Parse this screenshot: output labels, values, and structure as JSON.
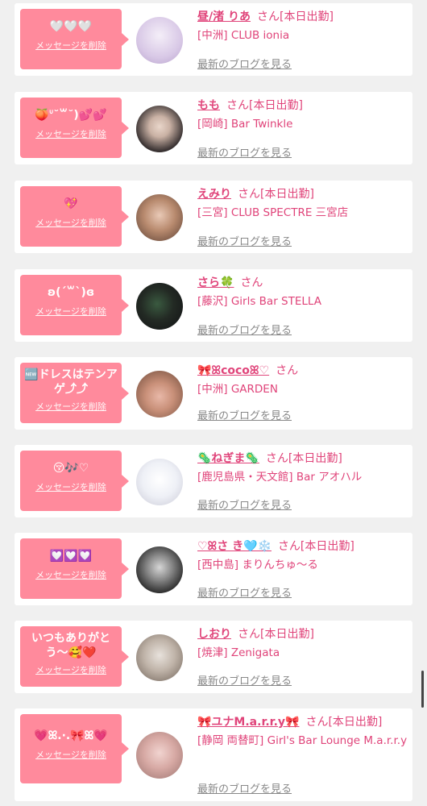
{
  "cards": [
    {
      "message": "🤍🤍🤍",
      "delete_label": "メッセージを削除",
      "name": "昼/渚 りあ",
      "san": "さん[本日出勤]",
      "shop": "[中洲] CLUB ionia",
      "blog_label": "最新のブログを見る",
      "avatar_colors": [
        "#e8e4f5",
        "#c7b3dd"
      ]
    },
    {
      "message": "🍑ᐡ˘꒳˘)💕💕",
      "delete_label": "メッセージを削除",
      "name": "もも",
      "san": "さん[本日出勤]",
      "shop": "[岡崎] Bar Twinkle",
      "blog_label": "最新のブログを見る",
      "avatar_colors": [
        "#3b3535",
        "#c9b8b0"
      ]
    },
    {
      "message": "💖",
      "delete_label": "メッセージを削除",
      "name": "えみり",
      "san": "さん[本日出勤]",
      "shop": "[三宮] CLUB SPECTRE 三宮店",
      "blog_label": "最新のブログを見る",
      "avatar_colors": [
        "#c9a58c",
        "#6b4d3e"
      ]
    },
    {
      "message": "ʚ(ˊ꒳ˋ)ɞ",
      "delete_label": "メッセージを削除",
      "name": "さら🍀",
      "san": "さん",
      "shop": "[藤沢] Girls Bar STELLA",
      "blog_label": "最新のブログを見る",
      "avatar_colors": [
        "#1a1a1f",
        "#3a5a40"
      ]
    },
    {
      "message": "🆕ドレスはテンアゲ⤴︎⤴︎",
      "delete_label": "メッセージを削除",
      "name": "🎀ꕤcocoꕤ♡",
      "san": "さん",
      "shop": "[中洲] GARDEN",
      "blog_label": "最新のブログを見る",
      "avatar_colors": [
        "#e6c9b5",
        "#b07a62"
      ]
    },
    {
      "message": "😚🎶♡",
      "delete_label": "メッセージを削除",
      "name": "🦠ねぎま🦠",
      "san": "さん[本日出勤]",
      "shop": "[鹿児島県・天文館] Bar アオハル",
      "blog_label": "最新のブログを見る",
      "avatar_colors": [
        "#f2f2f6",
        "#2b2b35"
      ]
    },
    {
      "message": "💟💟💟",
      "delete_label": "メッセージを削除",
      "name": "♡ꕤさ き🩵❄️",
      "san": "さん[本日出勤]",
      "shop": "[西中島] まりんちゅ〜る",
      "blog_label": "最新のブログを見る",
      "avatar_colors": [
        "#2a2a2a",
        "#9a9a9a"
      ]
    },
    {
      "message": "いつもありがとう〜🥰❤️",
      "delete_label": "メッセージを削除",
      "name": "しおり",
      "san": "さん[本日出勤]",
      "shop": "[焼津] Zenigata",
      "blog_label": "最新のブログを見る",
      "avatar_colors": [
        "#d8d0c8",
        "#7a6a60"
      ]
    },
    {
      "message": "💗ꕤ.·.🎀ꕤ💗",
      "delete_label": "メッセージを削除",
      "name": "🎀ユナM.a.r.r.y🎀",
      "san": "さん[本日出勤]",
      "shop": "[静岡 両替町] Girl's Bar Lounge M.a.r.r.y",
      "blog_label": "最新のブログを見る",
      "avatar_colors": [
        "#e8c4c4",
        "#b88a8a"
      ]
    }
  ]
}
